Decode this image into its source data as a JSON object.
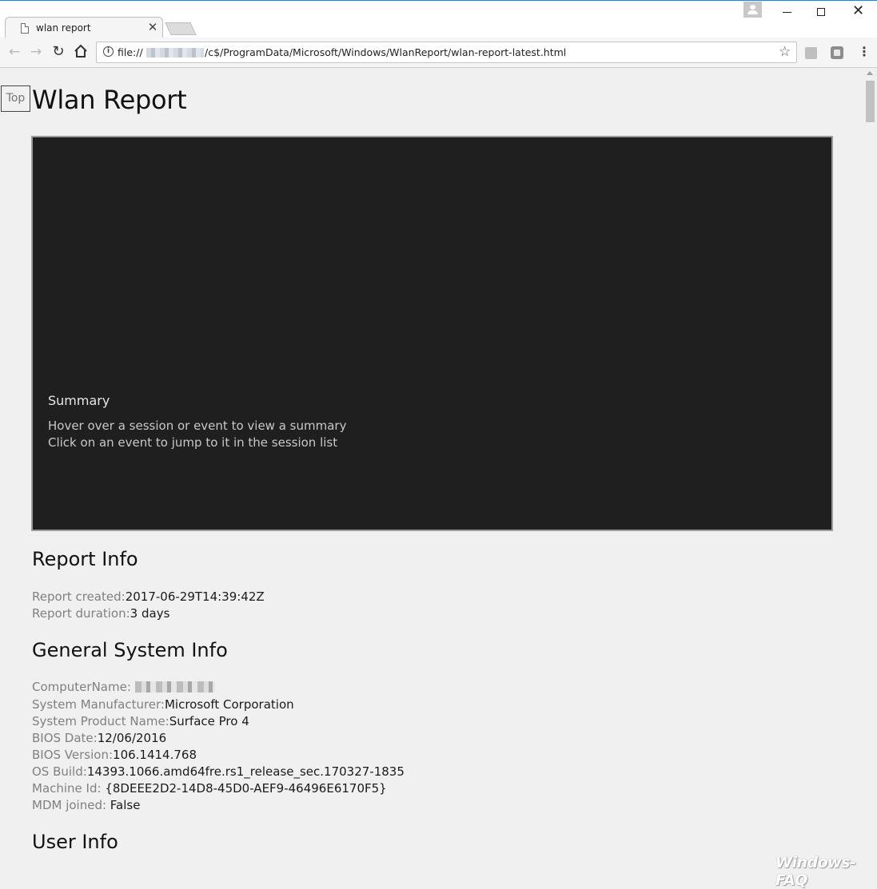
{
  "browser": {
    "tab_title": "wlan report",
    "tab_close": "✕",
    "url_prefix": "file://",
    "url_path": "/c$/ProgramData/Microsoft/Windows/WlanReport/wlan-report-latest.html",
    "back_icon": "←",
    "forward_icon": "→",
    "reload_icon": "↻",
    "info_icon": "i",
    "star_icon": "☆",
    "menu_icon": "⋮",
    "close_icon": "✕"
  },
  "page": {
    "top_link": "Top",
    "title": "Wlan Report"
  },
  "summary": {
    "heading": "Summary",
    "line1": "Hover over a session or event to view a summary",
    "line2": "Click on an event to jump to it in the session list"
  },
  "report_info": {
    "heading": "Report Info",
    "items": [
      {
        "label": "Report created:",
        "value": "2017-06-29T14:39:42Z"
      },
      {
        "label": "Report duration:",
        "value": "3 days"
      }
    ]
  },
  "general_system_info": {
    "heading": "General System Info",
    "items": [
      {
        "label": "ComputerName: ",
        "value": ""
      },
      {
        "label": "System Manufacturer:",
        "value": "Microsoft Corporation"
      },
      {
        "label": "System Product Name:",
        "value": "Surface Pro 4"
      },
      {
        "label": "BIOS Date:",
        "value": "12/06/2016"
      },
      {
        "label": "BIOS Version:",
        "value": "106.1414.768"
      },
      {
        "label": "OS Build:",
        "value": "14393.1066.amd64fre.rs1_release_sec.170327-1835"
      },
      {
        "label": "Machine Id: ",
        "value": "{8DEEE2D2-14D8-45D0-AEF9-46496E6170F5}"
      },
      {
        "label": "MDM joined: ",
        "value": "False"
      }
    ]
  },
  "user_info": {
    "heading": "User Info"
  },
  "watermark": "Windows-FAQ"
}
